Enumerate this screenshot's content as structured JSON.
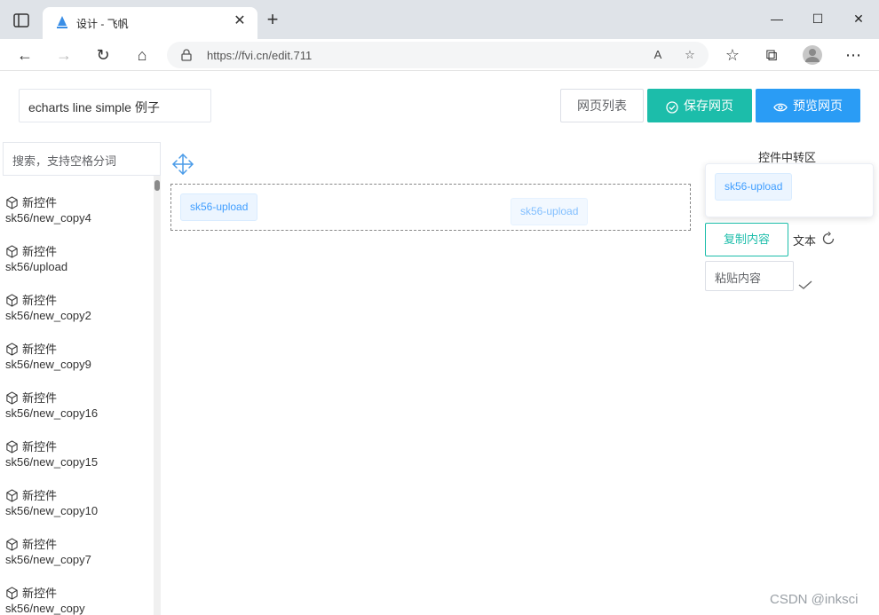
{
  "browser": {
    "tab_title": "设计 - 飞帆",
    "tab_close": "✕",
    "new_tab": "+",
    "url": "https://fvi.cn/edit.711",
    "window_controls": {
      "minimize": "—",
      "maximize": "☐",
      "close": "✕"
    },
    "nav": {
      "back": "←",
      "forward": "→",
      "reload": "↻",
      "home": "⌂"
    },
    "right_icons": {
      "read_aloud": "A",
      "favorite_add": "☆",
      "favorites": "☆",
      "collections": "⧉",
      "more": "⋯"
    }
  },
  "header": {
    "page_name": "echarts line simple 例子",
    "list_button": "网页列表",
    "save_button": "保存网页",
    "preview_button": "预览网页"
  },
  "sidebar": {
    "search_placeholder": "搜索，支持空格分词",
    "items": [
      {
        "label": "新控件",
        "path": "sk56/new_copy4"
      },
      {
        "label": "新控件",
        "path": "sk56/upload"
      },
      {
        "label": "新控件",
        "path": "sk56/new_copy2"
      },
      {
        "label": "新控件",
        "path": "sk56/new_copy9"
      },
      {
        "label": "新控件",
        "path": "sk56/new_copy16"
      },
      {
        "label": "新控件",
        "path": "sk56/new_copy15"
      },
      {
        "label": "新控件",
        "path": "sk56/new_copy10"
      },
      {
        "label": "新控件",
        "path": "sk56/new_copy7"
      },
      {
        "label": "新控件",
        "path": "sk56/new_copy"
      }
    ]
  },
  "canvas": {
    "chip_placed": "sk56-upload",
    "chip_dragging": "sk56-upload"
  },
  "transfer": {
    "title": "控件中转区",
    "chip": "sk56-upload",
    "copy_button": "复制内容",
    "text_label": "文本",
    "paste_placeholder": "粘贴内容"
  },
  "watermark": "CSDN @inksci",
  "colors": {
    "save": "#1cbdaa",
    "preview": "#2a9cf5",
    "chip_text": "#409eff"
  }
}
